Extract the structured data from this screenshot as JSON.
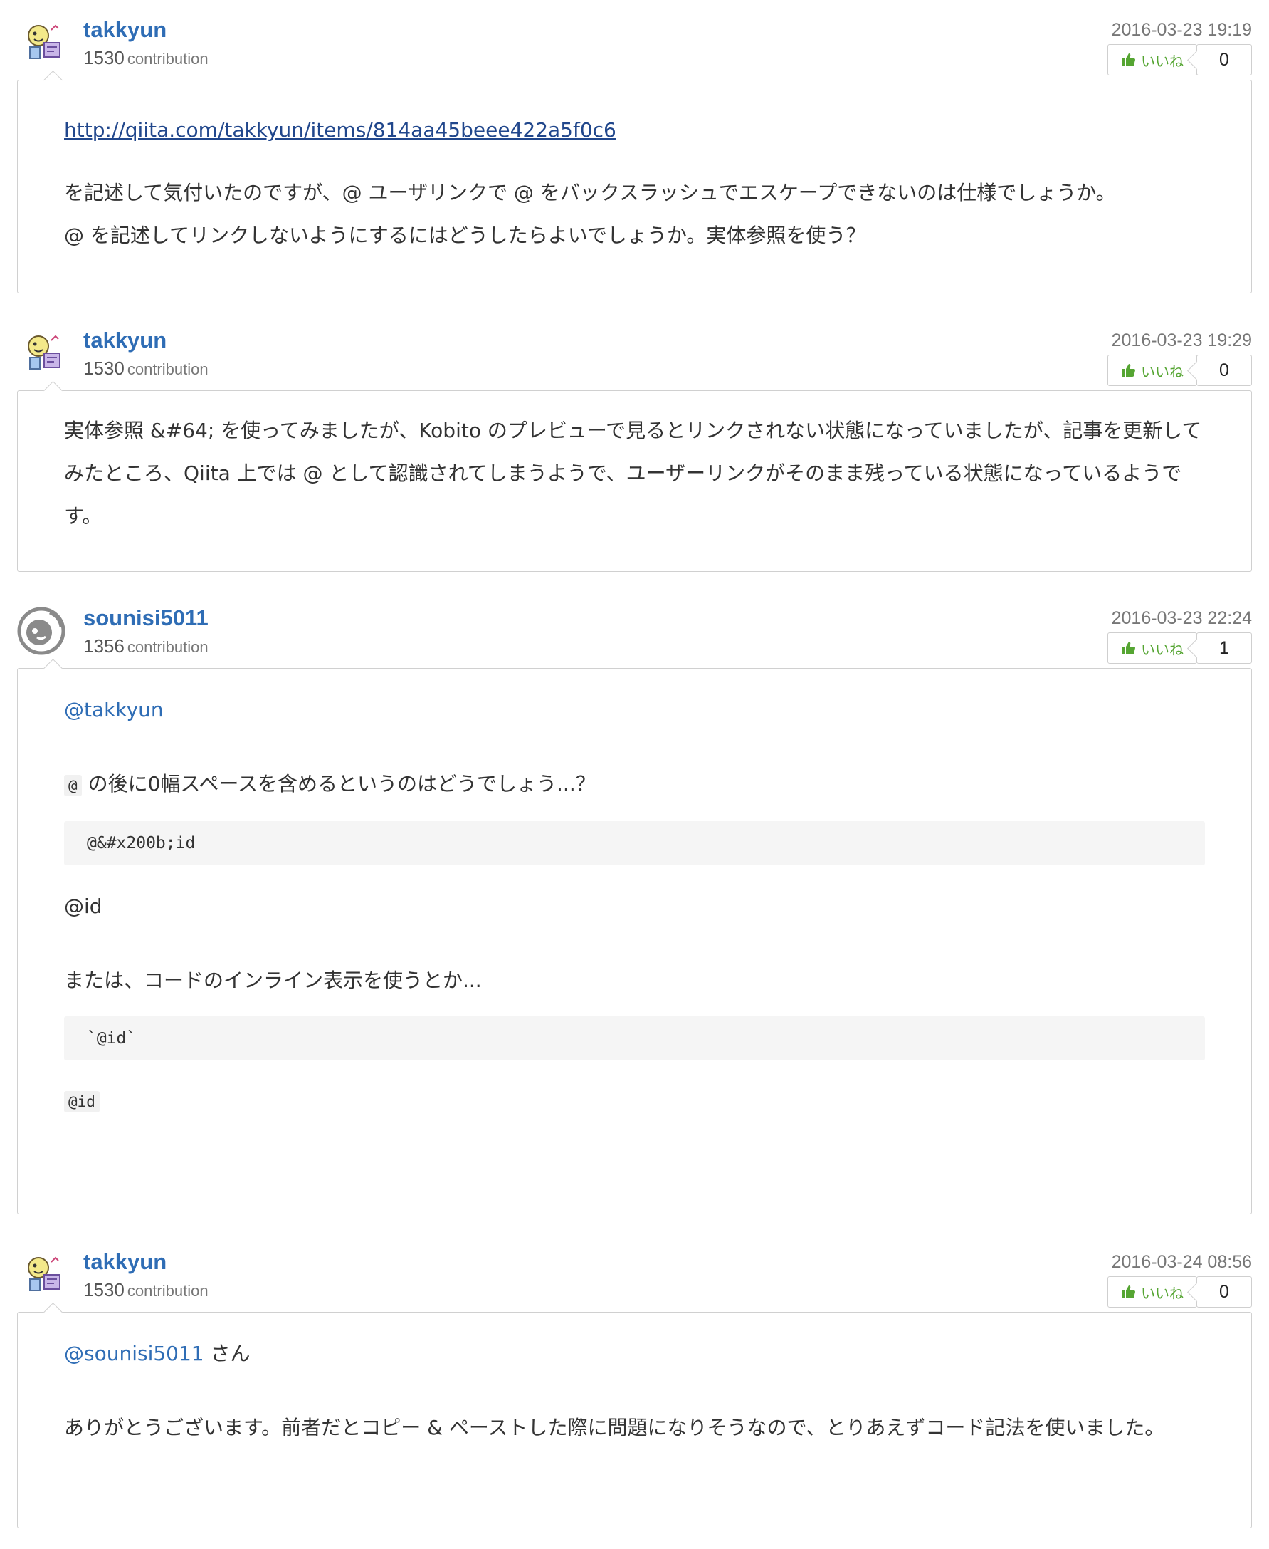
{
  "comments": [
    {
      "username": "takkyun",
      "contribution": "1530",
      "contribution_label": "contribution",
      "timestamp": "2016-03-23 19:19",
      "like_label": "いいね",
      "like_count": "0",
      "body": {
        "link": "http://qiita.com/takkyun/items/814aa45beee422a5f0c6",
        "line1": "を記述して気付いたのですが、@ ユーザリンクで @ をバックスラッシュでエスケープできないのは仕様でしょうか。",
        "line2": "@ を記述してリンクしないようにするにはどうしたらよいでしょうか。実体参照を使う？"
      }
    },
    {
      "username": "takkyun",
      "contribution": "1530",
      "contribution_label": "contribution",
      "timestamp": "2016-03-23 19:29",
      "like_label": "いいね",
      "like_count": "0",
      "body": {
        "text": "実体参照 &#64; を使ってみましたが、Kobito のプレビューで見るとリンクされない状態になっていましたが、記事を更新してみたところ、Qiita 上では @ として認識されてしまうようで、ユーザーリンクがそのまま残っている状態になっているようです。"
      }
    },
    {
      "username": "sounisi5011",
      "contribution": "1356",
      "contribution_label": "contribution",
      "timestamp": "2016-03-23 22:24",
      "like_label": "いいね",
      "like_count": "1",
      "body": {
        "mention": "@takkyun",
        "inline_at": "@",
        "text1": "の後に0幅スペースを含めるというのはどうでしょう...？",
        "code1": "@&#x200b;id",
        "rendered1": "@id",
        "text2": "または、コードのインライン表示を使うとか...",
        "code2": "`@id`",
        "rendered2": "@id"
      }
    },
    {
      "username": "takkyun",
      "contribution": "1530",
      "contribution_label": "contribution",
      "timestamp": "2016-03-24 08:56",
      "like_label": "いいね",
      "like_count": "0",
      "body": {
        "mention": "@sounisi5011",
        "mention_suffix": " さん",
        "text": "ありがとうございます。前者だとコピー & ペーストした際に問題になりそうなので、とりあえずコード記法を使いました。"
      }
    }
  ],
  "colors": {
    "username": "#2f6db5",
    "link": "#21478c",
    "like_green": "#55a532",
    "border": "#d0d0d0"
  },
  "icons": {
    "avatar_takkyun": "pixel-character-avatar",
    "avatar_sounisi5011": "grey-circular-logo-avatar",
    "like": "thumbs-up-icon"
  }
}
